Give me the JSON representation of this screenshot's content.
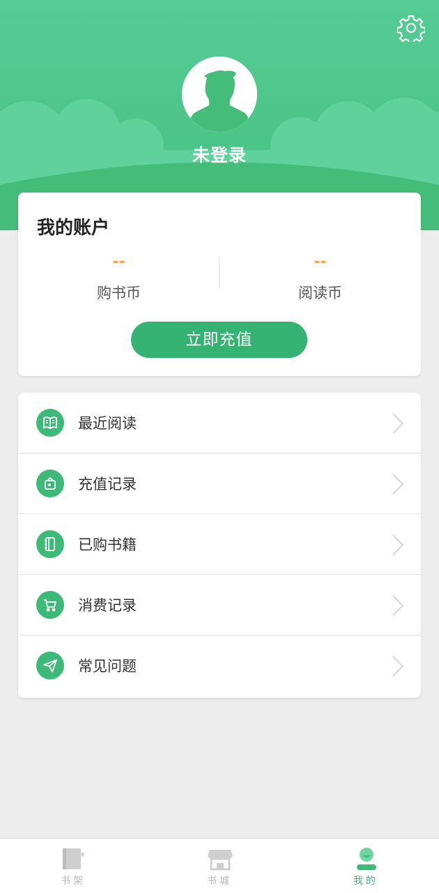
{
  "header": {
    "login_status": "未登录",
    "settings_icon": "gear-icon",
    "avatar_icon": "user-silhouette-icon",
    "bg_color": "#52c88c"
  },
  "account": {
    "title": "我的账户",
    "coins": [
      {
        "value": "--",
        "label": "购书币"
      },
      {
        "value": "--",
        "label": "阅读币"
      }
    ],
    "recharge_button": "立即充值",
    "accent": "#35b373"
  },
  "menu": {
    "items": [
      {
        "label": "最近阅读",
        "icon": "open-book-icon"
      },
      {
        "label": "充值记录",
        "icon": "wallet-icon"
      },
      {
        "label": "已购书籍",
        "icon": "notebook-icon"
      },
      {
        "label": "消费记录",
        "icon": "cart-icon"
      },
      {
        "label": "常见问题",
        "icon": "send-icon"
      }
    ]
  },
  "tabbar": {
    "tabs": [
      {
        "label": "书架",
        "icon": "bookshelf-icon",
        "active": false
      },
      {
        "label": "书城",
        "icon": "store-icon",
        "active": false
      },
      {
        "label": "我的",
        "icon": "profile-icon",
        "active": true
      }
    ],
    "active_color": "#3cba76",
    "inactive_color": "#b8b8b8"
  }
}
